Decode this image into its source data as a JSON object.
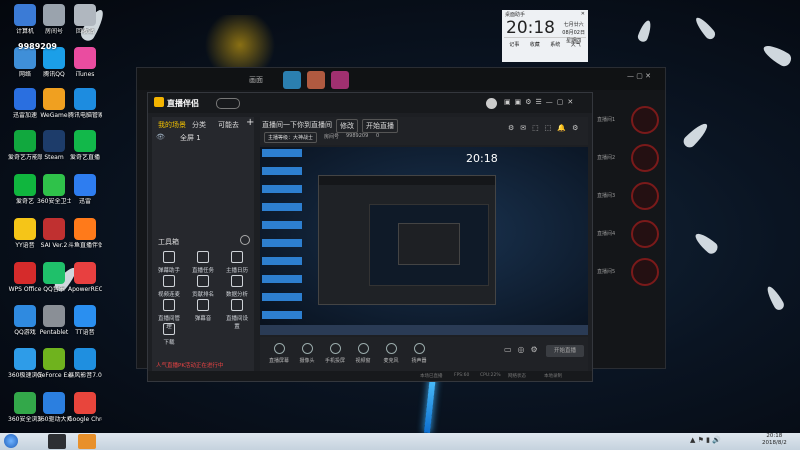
{
  "desktop": {
    "icons": [
      {
        "label": "计算机",
        "color": "#3b7bd6"
      },
      {
        "label": "房间号",
        "color": "#9aa3ad"
      },
      {
        "label": "回收站",
        "color": "#b0b7bf"
      },
      {
        "label": "网络",
        "color": "#3f8fd8"
      },
      {
        "label": "腾讯QQ",
        "color": "#1b9fe8"
      },
      {
        "label": "iTunes",
        "color": "#ea4ca0"
      },
      {
        "label": "迅雷加速",
        "color": "#2a6fe0"
      },
      {
        "label": "WeGame",
        "color": "#f0a020"
      },
      {
        "label": "腾讯电脑管家",
        "color": "#1d8ce0"
      },
      {
        "label": "爱奇艺万能联播",
        "color": "#11a83e"
      },
      {
        "label": "Steam",
        "color": "#1d3c6a"
      },
      {
        "label": "爱奇艺直播",
        "color": "#12b84a"
      },
      {
        "label": "爱奇艺",
        "color": "#10b63e"
      },
      {
        "label": "360安全卫士",
        "color": "#2fc24a"
      },
      {
        "label": "迅雷",
        "color": "#2e7df0"
      },
      {
        "label": "YY语音",
        "color": "#f5c518"
      },
      {
        "label": "SAI Ver.2",
        "color": "#c03030"
      },
      {
        "label": "斗鱼直播伴侣",
        "color": "#ff7a1a"
      },
      {
        "label": "WPS Office",
        "color": "#d52b2b"
      },
      {
        "label": "QQ音乐",
        "color": "#1fc06a"
      },
      {
        "label": "ApowerREC",
        "color": "#e84040"
      },
      {
        "label": "QQ游戏",
        "color": "#2f8ae0"
      },
      {
        "label": "Pentablet",
        "color": "#8a8f96"
      },
      {
        "label": "TT语音",
        "color": "#2a8ff0"
      },
      {
        "label": "360极速浏览器",
        "color": "#2e9ce8"
      },
      {
        "label": "GeForce Experience",
        "color": "#6fb31e"
      },
      {
        "label": "暴风影音7.0",
        "color": "#1f8fe0"
      },
      {
        "label": "360安全浏览器",
        "color": "#33a84a"
      },
      {
        "label": "360驱动大师",
        "color": "#2b7fe0"
      },
      {
        "label": "Google Chrome",
        "color": "#e8453c"
      }
    ],
    "room_number": "9989209"
  },
  "clock": {
    "header": "桌面助手",
    "time": "20:18",
    "date": "七月廿六",
    "date2": "08月02日",
    "weekday": "星期四",
    "footer": [
      "记事",
      "收藏",
      "系统",
      "天气"
    ]
  },
  "main": {
    "brand": "直播伴侣",
    "left_tabs": [
      "我的场景",
      "分类",
      "可能去"
    ],
    "scene_item": "全屏 1",
    "tools_title": "工具箱",
    "tools": [
      "弹幕助手",
      "直播任务",
      "主播日历",
      "视频连麦",
      "贡献排名",
      "数据分析",
      "直播间管理",
      "弹幕音",
      "直播间设置",
      "下载"
    ],
    "notice": "人气直播PK活动正在进行中",
    "room_title": "直播间一下你到直播间",
    "room_tag": "修改",
    "room_btn": "开始直播",
    "room_meta": "主播等级：大神战士",
    "room_id_label": "房间号",
    "room_id": "9989209",
    "viewers": "0",
    "bottom_tools": [
      "直播屏幕",
      "摄像头",
      "手机投屏",
      "视频窗",
      "麦克风",
      "扬声器"
    ],
    "start_btn": "开始直播",
    "status": [
      "本场已直播",
      "FPS:60",
      "CPU:22%",
      "网络状态",
      "本地录制"
    ]
  },
  "bg_window": {
    "tab": "画面",
    "slots": [
      "直播间1",
      "直播间2",
      "直播间3",
      "直播间4",
      "直播间5"
    ]
  },
  "taskbar": {
    "time": "20:18",
    "date": "2018/8/2"
  }
}
